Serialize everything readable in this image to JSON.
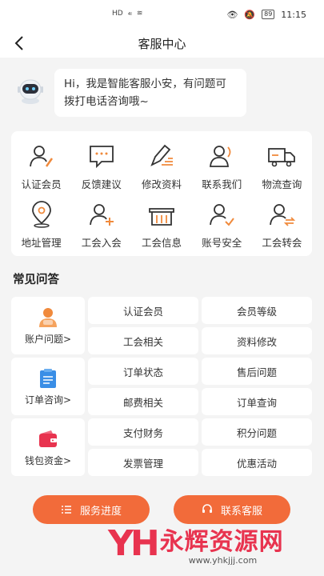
{
  "status": {
    "time": "11:15",
    "battery": "89"
  },
  "nav": {
    "title": "客服中心"
  },
  "greeting": {
    "text": "Hi，我是智能客服小安，有问题可拨打电话咨询哦~"
  },
  "services": [
    {
      "label": "认证会员",
      "icon": "member-verify-icon"
    },
    {
      "label": "反馈建议",
      "icon": "feedback-icon"
    },
    {
      "label": "修改资料",
      "icon": "edit-profile-icon"
    },
    {
      "label": "联系我们",
      "icon": "contact-icon"
    },
    {
      "label": "物流查询",
      "icon": "truck-icon"
    },
    {
      "label": "地址管理",
      "icon": "location-icon"
    },
    {
      "label": "工会入会",
      "icon": "join-union-icon"
    },
    {
      "label": "工会信息",
      "icon": "union-info-icon"
    },
    {
      "label": "账号安全",
      "icon": "account-security-icon"
    },
    {
      "label": "工会转会",
      "icon": "transfer-union-icon"
    }
  ],
  "faq": {
    "title": "常见问答",
    "groups": [
      {
        "category": "账户问题>",
        "icon": "vip-user-icon",
        "items": [
          "认证会员",
          "会员等级",
          "工会相关",
          "资料修改"
        ]
      },
      {
        "category": "订单咨询>",
        "icon": "clipboard-icon",
        "items": [
          "订单状态",
          "售后问题",
          "邮费相关",
          "订单查询"
        ]
      },
      {
        "category": "钱包资金>",
        "icon": "wallet-icon",
        "items": [
          "支付财务",
          "积分问题",
          "发票管理",
          "优惠活动"
        ]
      }
    ]
  },
  "buttons": {
    "progress": "服务进度",
    "contact": "联系客服"
  },
  "watermark": {
    "logo": "YH",
    "name": "永辉资源网",
    "url": "www.yhkjjj.com"
  },
  "colors": {
    "accent": "#f26b3a",
    "icon_orange": "#f08a3c",
    "icon_blue": "#3a8ee6",
    "icon_red": "#e8334f"
  }
}
